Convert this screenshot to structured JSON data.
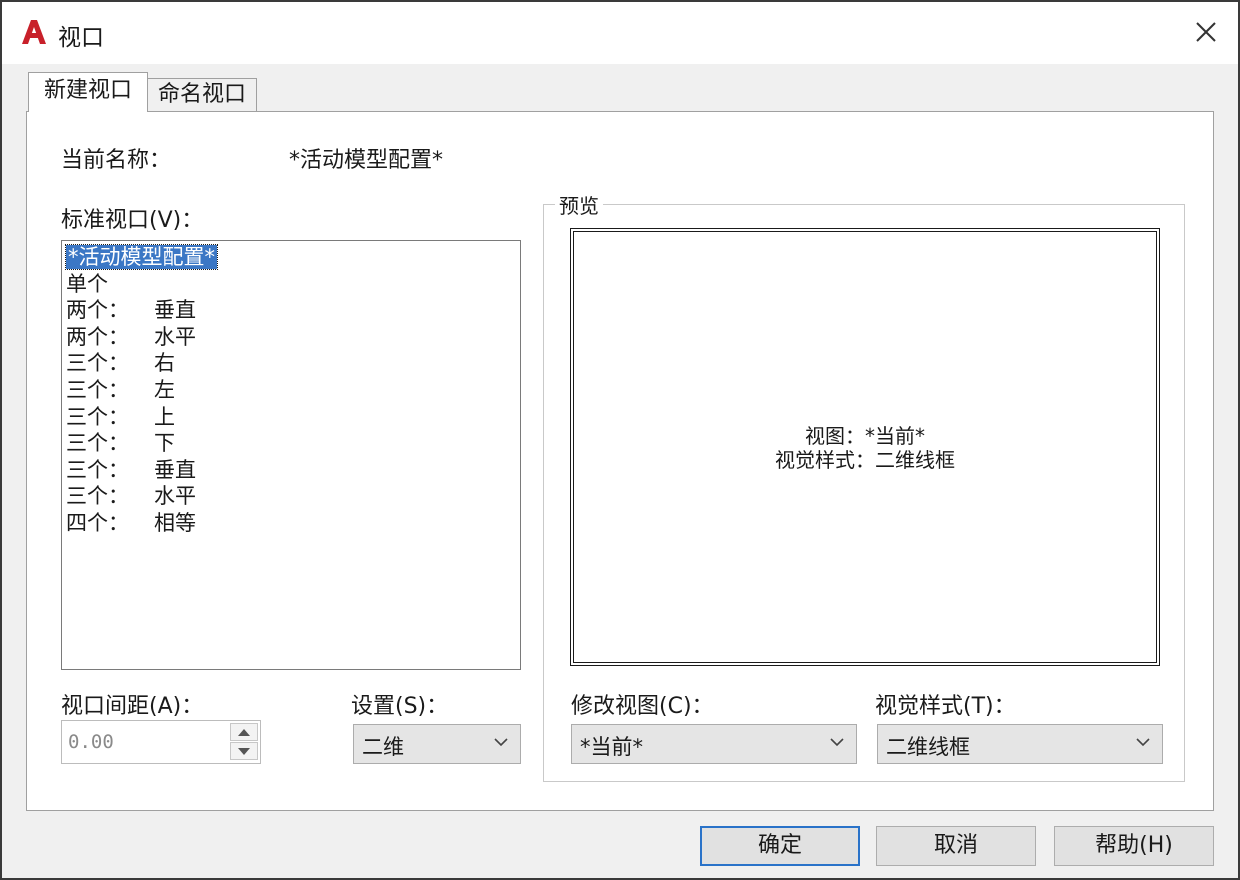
{
  "window": {
    "title": "视口"
  },
  "tabs": [
    {
      "label": "新建视口",
      "active": true
    },
    {
      "label": "命名视口",
      "active": false
    }
  ],
  "current_name": {
    "label": "当前名称：",
    "value": "*活动模型配置*"
  },
  "standard_viewports": {
    "label": "标准视口(V)：",
    "items": [
      {
        "c1": "*活动模型配置*",
        "c2": "",
        "selected": true
      },
      {
        "c1": "单个",
        "c2": ""
      },
      {
        "c1": "两个：",
        "c2": "垂直"
      },
      {
        "c1": "两个：",
        "c2": "水平"
      },
      {
        "c1": "三个：",
        "c2": "右"
      },
      {
        "c1": "三个：",
        "c2": "左"
      },
      {
        "c1": "三个：",
        "c2": "上"
      },
      {
        "c1": "三个：",
        "c2": "下"
      },
      {
        "c1": "三个：",
        "c2": "垂直"
      },
      {
        "c1": "三个：",
        "c2": "水平"
      },
      {
        "c1": "四个：",
        "c2": "相等"
      }
    ]
  },
  "preview": {
    "legend": "预览",
    "view_line": "视图：*当前*",
    "style_line": "视觉样式：二维线框"
  },
  "viewport_spacing": {
    "label": "视口间距(A)：",
    "value": "0.00"
  },
  "setup": {
    "label": "设置(S)：",
    "value": "二维"
  },
  "change_view": {
    "label": "修改视图(C)：",
    "value": "*当前*"
  },
  "visual_style": {
    "label": "视觉样式(T)：",
    "value": "二维线框"
  },
  "buttons": {
    "ok": "确定",
    "cancel": "取消",
    "help": "帮助(H)"
  },
  "icons": {
    "app": "autocad-logo-icon",
    "close": "close-icon",
    "dropdown": "chevron-down-icon"
  },
  "colors": {
    "selection": "#3b77c5",
    "logo": "#c8202a",
    "ok_border": "#2a73c9"
  }
}
